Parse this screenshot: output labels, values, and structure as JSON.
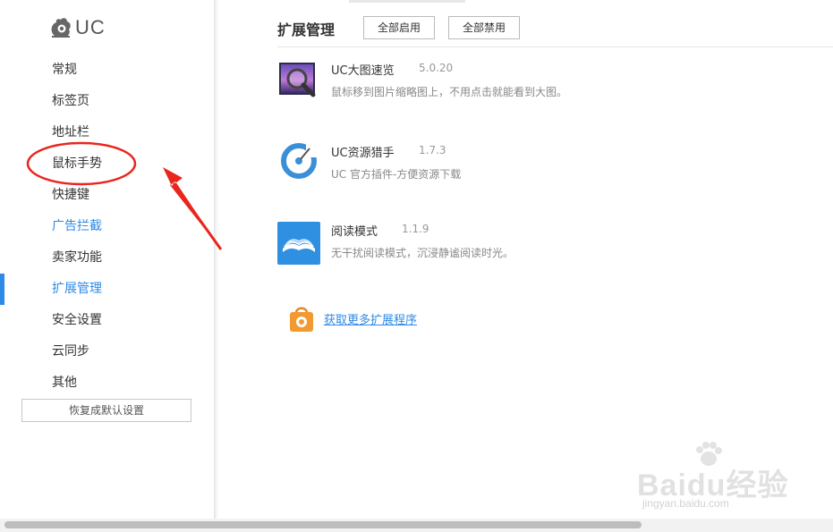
{
  "sidebar": {
    "logo_text": "UC",
    "items": [
      {
        "label": "常规"
      },
      {
        "label": "标签页"
      },
      {
        "label": "地址栏"
      },
      {
        "label": "鼠标手势"
      },
      {
        "label": "快捷键"
      },
      {
        "label": "广告拦截"
      },
      {
        "label": "卖家功能"
      },
      {
        "label": "扩展管理"
      },
      {
        "label": "安全设置"
      },
      {
        "label": "云同步"
      },
      {
        "label": "其他"
      }
    ],
    "active_item": "扩展管理",
    "restore_label": "恢复成默认设置"
  },
  "main": {
    "title": "扩展管理",
    "enable_all_label": "全部启用",
    "disable_all_label": "全部禁用",
    "extensions": [
      {
        "name": "UC大图速览",
        "version": "5.0.20",
        "description": "鼠标移到图片缩略图上，不用点击就能看到大图。",
        "icon": "image-magnifier-icon"
      },
      {
        "name": "UC资源猎手",
        "version": "1.7.3",
        "description": "UC 官方插件-方便资源下载",
        "icon": "resource-hunter-icon"
      },
      {
        "name": "阅读模式",
        "version": "1.1.9",
        "description": "无干扰阅读模式，沉浸静谧阅读时光。",
        "icon": "open-book-icon"
      }
    ],
    "get_more_label": "获取更多扩展程序"
  },
  "watermark": {
    "main": "Baidu经验",
    "sub": "jingyan.baidu.com"
  },
  "colors": {
    "accent": "#2e8ae6",
    "annotation_red": "#e8261d"
  }
}
